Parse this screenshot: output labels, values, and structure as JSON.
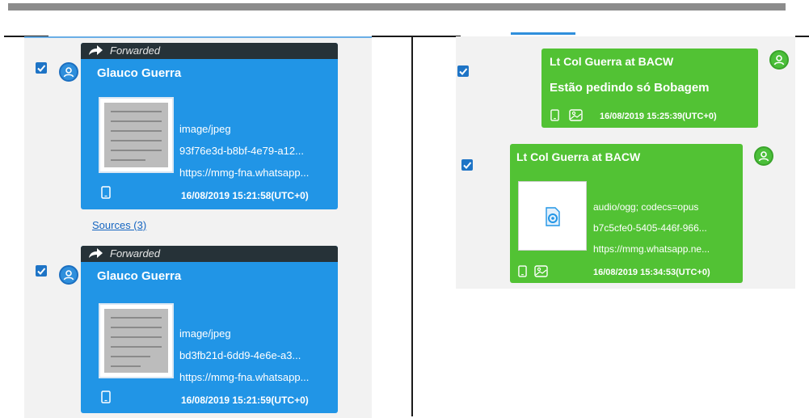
{
  "colors": {
    "blue_bubble": "#2195e6",
    "forward_bar": "#263238",
    "green_bubble": "#52c234",
    "pane_bg": "#f2f2f2",
    "checkbox": "#1e74c6",
    "link": "#1565c0"
  },
  "left_messages": [
    {
      "forwarded_label": "Forwarded",
      "sender": "Glauco Guerra",
      "mime": "image/jpeg",
      "file_id": "93f76e3d-b8bf-4e79-a12...",
      "url": "https://mmg-fna.whatsapp...",
      "timestamp": "16/08/2019 15:21:58(UTC+0)",
      "icons": [
        "phone-icon"
      ]
    },
    {
      "forwarded_label": "Forwarded",
      "sender": "Glauco Guerra",
      "mime": "image/jpeg",
      "file_id": "bd3fb21d-6dd9-4e6e-a3...",
      "url": "https://mmg-fna.whatsapp...",
      "timestamp": "16/08/2019 15:21:59(UTC+0)",
      "icons": [
        "phone-icon"
      ]
    }
  ],
  "sources_link": "Sources (3)",
  "right_messages": [
    {
      "sender": "Lt Col Guerra at BACW",
      "body": "Estão pedindo só Bobagem",
      "timestamp": "16/08/2019 15:25:39(UTC+0)",
      "icons": [
        "phone-icon",
        "gallery-icon"
      ]
    },
    {
      "sender": "Lt Col Guerra at BACW",
      "mime": "audio/ogg; codecs=opus",
      "file_id": "b7c5cfe0-5405-446f-966...",
      "url": "https://mmg.whatsapp.ne...",
      "timestamp": "16/08/2019 15:34:53(UTC+0)",
      "icons": [
        "phone-icon",
        "gallery-icon"
      ],
      "attachment_icon": "audio-file-icon"
    }
  ]
}
